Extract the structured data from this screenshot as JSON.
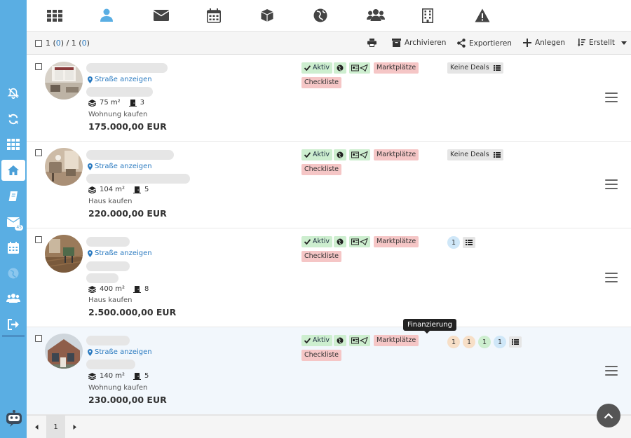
{
  "toolbar": {
    "selection_count": "1",
    "selected": "0",
    "separator": " / ",
    "total": "1",
    "total_selected": "0",
    "archive_label": "Archivieren",
    "export_label": "Exportieren",
    "create_label": "Anlegen",
    "sort_label": "Erstellt"
  },
  "sidebar": {
    "mail_badge": "45"
  },
  "rows": [
    {
      "street": "Straße anzeigen",
      "area": "75 m²",
      "rooms": "3",
      "type": "Wohnung kaufen",
      "price": "175.000,00 EUR"
    },
    {
      "street": "Straße anzeigen",
      "area": "104 m²",
      "rooms": "5",
      "type": "Haus kaufen",
      "price": "220.000,00 EUR"
    },
    {
      "street": "Straße anzeigen",
      "area": "400 m²",
      "rooms": "8",
      "type": "Haus kaufen",
      "price": "2.500.000,00 EUR"
    },
    {
      "street": "Straße anzeigen",
      "area": "140 m²",
      "rooms": "5",
      "type": "Wohnung kaufen",
      "price": "230.000,00 EUR"
    }
  ],
  "tags": {
    "active": "Aktiv",
    "markets": "Marktplätze",
    "checklist": "Checkliste",
    "no_deals": "Keine Deals"
  },
  "deals": {
    "row3": [
      "1"
    ],
    "row4": [
      "1",
      "1",
      "1",
      "1"
    ]
  },
  "tooltip": "Finanzierung",
  "pager": {
    "page": "1"
  },
  "colors": {
    "sidebar": "#5aaee3",
    "link": "#2a7ac0",
    "tag_green": "#cdeecf",
    "tag_red": "#f5c6c6"
  }
}
